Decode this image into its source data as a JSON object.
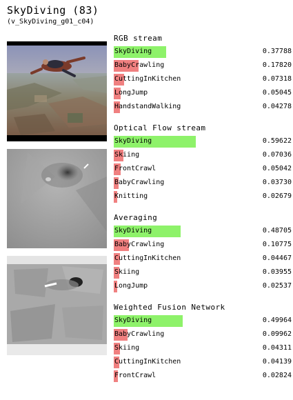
{
  "header": {
    "title": "SkyDiving (83)",
    "video_id": "(v_SkyDiving_g01_c04)"
  },
  "frames": [
    {
      "name": "rgb-frame"
    },
    {
      "name": "optical-flow-frame"
    },
    {
      "name": "fusion-frame"
    }
  ],
  "colors": {
    "top_prediction_bar": "#8ef26a",
    "other_prediction_bar": "#f08080"
  },
  "sections": [
    {
      "title": "RGB stream",
      "predictions": [
        {
          "label": "SkyDiving",
          "score": "0.37788",
          "value": 0.37788
        },
        {
          "label": "BabyCrawling",
          "score": "0.17820",
          "value": 0.1782
        },
        {
          "label": "CuttingInKitchen",
          "score": "0.07318",
          "value": 0.07318
        },
        {
          "label": "LongJump",
          "score": "0.05045",
          "value": 0.05045
        },
        {
          "label": "HandstandWalking",
          "score": "0.04278",
          "value": 0.04278
        }
      ]
    },
    {
      "title": "Optical Flow stream",
      "predictions": [
        {
          "label": "SkyDiving",
          "score": "0.59622",
          "value": 0.59622
        },
        {
          "label": "Skiing",
          "score": "0.07036",
          "value": 0.07036
        },
        {
          "label": "FrontCrawl",
          "score": "0.05042",
          "value": 0.05042
        },
        {
          "label": "BabyCrawling",
          "score": "0.03730",
          "value": 0.0373
        },
        {
          "label": "Knitting",
          "score": "0.02679",
          "value": 0.02679
        }
      ]
    },
    {
      "title": "Averaging",
      "predictions": [
        {
          "label": "SkyDiving",
          "score": "0.48705",
          "value": 0.48705
        },
        {
          "label": "BabyCrawling",
          "score": "0.10775",
          "value": 0.10775
        },
        {
          "label": "CuttingInKitchen",
          "score": "0.04467",
          "value": 0.04467
        },
        {
          "label": "Skiing",
          "score": "0.03955",
          "value": 0.03955
        },
        {
          "label": "LongJump",
          "score": "0.02537",
          "value": 0.02537
        }
      ]
    },
    {
      "title": "Weighted Fusion Network",
      "predictions": [
        {
          "label": "SkyDiving",
          "score": "0.49964",
          "value": 0.49964
        },
        {
          "label": "BabyCrawling",
          "score": "0.09962",
          "value": 0.09962
        },
        {
          "label": "Skiing",
          "score": "0.04311",
          "value": 0.04311
        },
        {
          "label": "CuttingInKitchen",
          "score": "0.04139",
          "value": 0.04139
        },
        {
          "label": "FrontCrawl",
          "score": "0.02824",
          "value": 0.02824
        }
      ]
    }
  ]
}
